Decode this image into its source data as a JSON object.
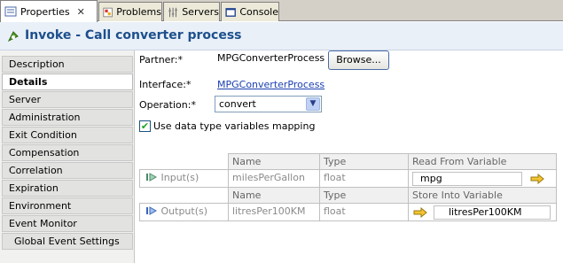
{
  "tabs": [
    {
      "label": "Properties",
      "icon": "properties-icon",
      "active": true
    },
    {
      "label": "Problems",
      "icon": "problems-icon",
      "active": false
    },
    {
      "label": "Servers",
      "icon": "servers-icon",
      "active": false
    },
    {
      "label": "Console",
      "icon": "console-icon",
      "active": false
    }
  ],
  "header": {
    "title": "Invoke - Call converter process",
    "icon": "invoke-icon"
  },
  "nav": {
    "items": [
      {
        "label": "Description"
      },
      {
        "label": "Details"
      },
      {
        "label": "Server"
      },
      {
        "label": "Administration"
      },
      {
        "label": "Exit Condition"
      },
      {
        "label": "Compensation"
      },
      {
        "label": "Correlation"
      },
      {
        "label": "Expiration"
      },
      {
        "label": "Environment"
      },
      {
        "label": "Event Monitor"
      },
      {
        "label": "Global Event Settings"
      }
    ],
    "selected": "Details"
  },
  "form": {
    "partner_label": "Partner:*",
    "partner_value": "MPGConverterProcess",
    "browse_label": "Browse...",
    "interface_label": "Interface:*",
    "interface_link": "MPGConverterProcess",
    "operation_label": "Operation:*",
    "operation_value": "convert",
    "mapping_checkbox_label": "Use data type variables mapping",
    "mapping_checked": true
  },
  "io_table": {
    "input": {
      "label": "Input(s)",
      "headers": [
        "Name",
        "Type",
        "Read From Variable"
      ],
      "name": "milesPerGallon",
      "type": "float",
      "variable": "mpg"
    },
    "output": {
      "label": "Output(s)",
      "headers": [
        "Name",
        "Type",
        "Store Into Variable"
      ],
      "name": "litresPer100KM",
      "type": "float",
      "variable": "litresPer100KM"
    }
  },
  "colors": {
    "header_title": "#1c4f8c",
    "link": "#1a3fb0",
    "arrow": "#f4c430"
  }
}
